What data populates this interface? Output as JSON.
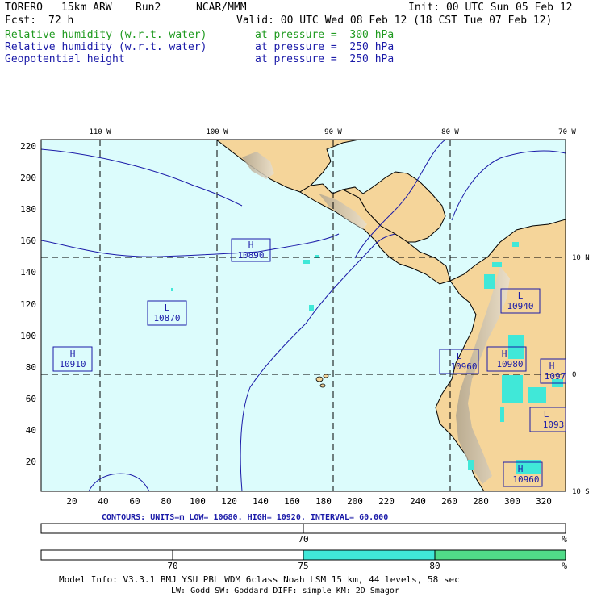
{
  "header": {
    "model": "TORERO",
    "resolution": "15km ARW",
    "run": "Run2",
    "org": "NCAR/MMM",
    "init": "Init: 00 UTC Sun 05 Feb 12",
    "fcst_label": "Fcst:",
    "fcst_value": "72 h",
    "valid": "Valid: 00 UTC Wed 08 Feb 12 (18 CST Tue 07 Feb 12)"
  },
  "fields": [
    {
      "name": "Relative humidity (w.r.t. water)",
      "level": "at pressure =  300 hPa",
      "color": "#1f9a1f"
    },
    {
      "name": "Relative humidity (w.r.t. water)",
      "level": "at pressure =  250 hPa",
      "color": "#1a1aa8"
    },
    {
      "name": "Geopotential height",
      "level": "at pressure =  250 hPa",
      "color": "#1a1aa8"
    }
  ],
  "map": {
    "ocean_color": "#dcfcfc",
    "land_color": "#f5d59a",
    "lon_labels": [
      "110 W",
      "100 W",
      "90 W",
      "80 W",
      "70 W"
    ],
    "lat_labels": [
      "10 N",
      "0",
      "10 S"
    ],
    "y_ticks": [
      "220",
      "200",
      "180",
      "160",
      "140",
      "120",
      "100",
      "80",
      "60",
      "40",
      "20"
    ],
    "x_ticks": [
      "20",
      "40",
      "60",
      "80",
      "100",
      "120",
      "140",
      "160",
      "180",
      "200",
      "220",
      "240",
      "260",
      "280",
      "300",
      "320"
    ],
    "pressure_centers": [
      {
        "type": "H",
        "value": "10890"
      },
      {
        "type": "L",
        "value": "10870"
      },
      {
        "type": "H",
        "value": "10910"
      },
      {
        "type": "L",
        "value": "10940"
      },
      {
        "type": "L",
        "value": "10960"
      },
      {
        "type": "H",
        "value": "10980"
      },
      {
        "type": "H",
        "value": "1097"
      },
      {
        "type": "L",
        "value": "1093"
      },
      {
        "type": "H",
        "value": "10960"
      }
    ]
  },
  "contours_line": "CONTOURS:  UNITS=m  LOW=  10680.      HIGH=  10920.      INTERVAL=  60.000",
  "colorbar1": {
    "tick": "70",
    "unit": "%"
  },
  "colorbar2": {
    "ticks": [
      "70",
      "75",
      "80"
    ],
    "unit": "%",
    "colors": [
      "#ffffff",
      "#40e8d8",
      "#50dc88"
    ]
  },
  "footer": {
    "line1": "Model Info: V3.3.1    BMJ     YSU PBL   WDM 6class  Noah LSM  15 km,    44 levels,    58 sec",
    "line2": "LW: Godd SW: Goddard DIFF: simple KM: 2D Smagor"
  }
}
